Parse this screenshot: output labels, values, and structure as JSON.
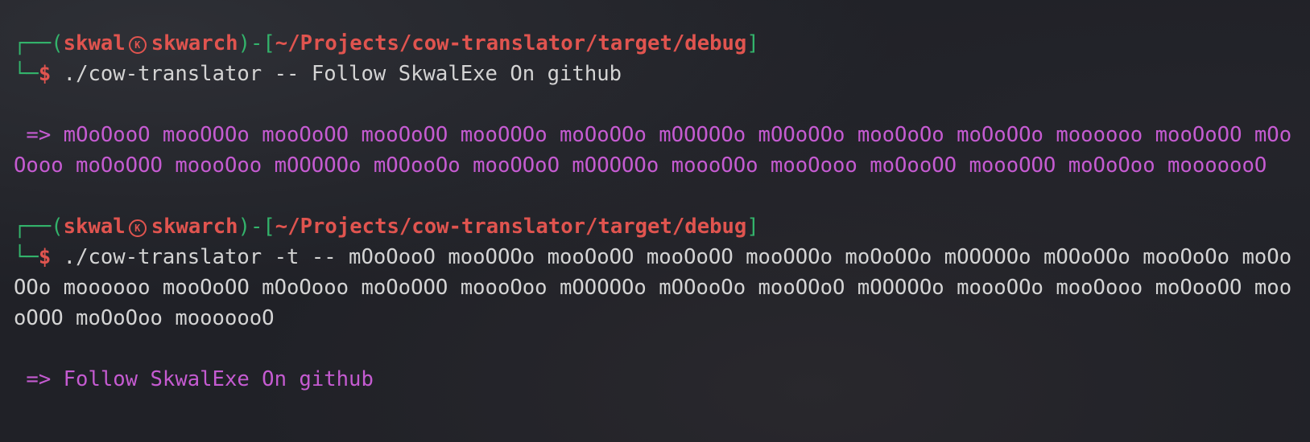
{
  "prompt1": {
    "box_top": "┌──(",
    "user": "skwal",
    "icon": "kali-icon",
    "host": "skwarch",
    "mid": ")-[",
    "path": "~/Projects/cow-translator/target/debug",
    "close": "]",
    "box_bottom": "└─",
    "dollar": "$",
    "command": " ./cow-translator -- Follow SkwalExe On github"
  },
  "output1": {
    "arrow": " => ",
    "text": "mOoOooO mooOOOo mooOoOO mooOoOO mooOOOo moOoOOo mOOOOOo mOOoOOo mooOoOo moOoOOo moooooo mooOoOO mOoOooo moOoOOO moooOoo mOOOOOo mOOooOo mooOOoO mOOOOOo moooOOo mooOooo moOooOO moooOOO moOoOoo mooooooO"
  },
  "prompt2": {
    "box_top": "┌──(",
    "user": "skwal",
    "icon": "kali-icon",
    "host": "skwarch",
    "mid": ")-[",
    "path": "~/Projects/cow-translator/target/debug",
    "close": "]",
    "box_bottom": "└─",
    "dollar": "$",
    "command": " ./cow-translator -t -- mOoOooO mooOOOo mooOoOO mooOoOO mooOOOo moOoOOo mOOOOOo mOOoOOo mooOoOo moOoOOo moooooo mooOoOO mOoOooo moOoOOO moooOoo mOOOOOo mOOooOo mooOOoO mOOOOOo moooOOo mooOooo moOooOO moooOOO moOoOoo mooooooO"
  },
  "output2": {
    "arrow": " => ",
    "text": "Follow SkwalExe On github"
  }
}
